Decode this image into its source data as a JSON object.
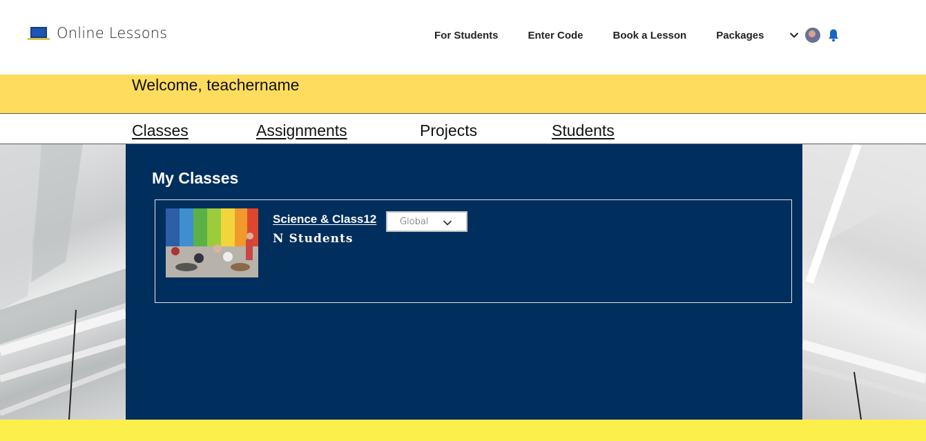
{
  "header": {
    "logo_text": "Online Lessons",
    "nav": [
      {
        "label": "For Students"
      },
      {
        "label": "Enter Code"
      },
      {
        "label": "Book a Lesson"
      },
      {
        "label": "Packages"
      }
    ]
  },
  "welcome": {
    "text": "Welcome, teachername"
  },
  "tabs": [
    {
      "label": "Classes",
      "underlined": true
    },
    {
      "label": "Assignments",
      "underlined": true
    },
    {
      "label": "Projects",
      "underlined": false
    },
    {
      "label": "Students",
      "underlined": true
    }
  ],
  "main": {
    "title": "My Classes",
    "classes": [
      {
        "name": "Science & Class12",
        "students_text": "N  Students",
        "scope_value": "Global"
      }
    ]
  },
  "colors": {
    "yellow_band": "#fedc5e",
    "footer_yellow": "#fcef4c",
    "panel_navy": "#002e5d",
    "bell_blue": "#1a64c4"
  },
  "icons": [
    "laptop-logo-icon",
    "chevron-down-icon",
    "avatar",
    "bell-icon",
    "chevron-down-icon"
  ]
}
